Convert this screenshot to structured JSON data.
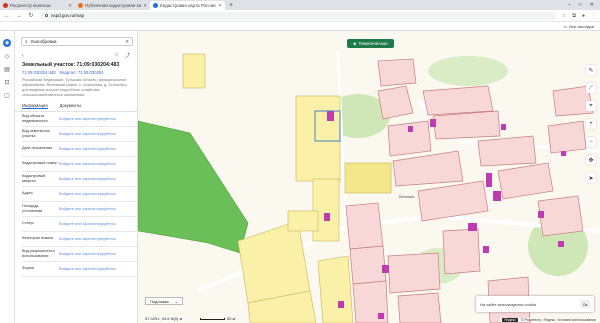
{
  "browser": {
    "tabs": [
      {
        "label": "Росреестр выписка",
        "favicon_color": "#d93025"
      },
      {
        "label": "Публичная кадастровая ка",
        "favicon_color": "#e8711a"
      },
      {
        "label": "Кадастровая карта России",
        "favicon_color": "#1e6fd9",
        "active": true
      }
    ],
    "new_tab": "+",
    "url": "nspd.gov.ru/map",
    "bookmarks_label": "Все закладки",
    "window_controls": [
      "–",
      "□",
      "✕"
    ]
  },
  "search": {
    "value": "Ушлобровка"
  },
  "object": {
    "title": "Земельный участок: 71:09:030204:483",
    "cadastral_link": "71:09:030204:483",
    "cadastral_link2": "Квартал: 71:09:030204",
    "description": "Российская Федерация, Тульская область, муниципальное образование, Веневский район, с. Апалькова, д. Устьвобро, для ведения личного подсобного хозяйства, сельскохозяйственного назначения"
  },
  "tabs": {
    "info": "Информация",
    "docs": "Документы"
  },
  "rows": [
    {
      "k": "Вид объекта недвижимости",
      "v": "Войдите или зарегистрируйтесь"
    },
    {
      "k": "Вид земельного участка",
      "v": "Войдите или зарегистрируйтесь"
    },
    {
      "k": "Дата присвоения",
      "v": "Войдите или зарегистрируйтесь"
    },
    {
      "k": "Кадастровый номер",
      "v": "Войдите или зарегистрируйтесь"
    },
    {
      "k": "Кадастровый квартал",
      "v": "Войдите или зарегистрируйтесь"
    },
    {
      "k": "Адрес",
      "v": "Войдите или зарегистрируйтесь"
    },
    {
      "k": "Площадь уточненная",
      "v": "Войдите или зарегистрируйтесь"
    },
    {
      "k": "Статус",
      "v": "Войдите или зарегистрируйтесь"
    },
    {
      "k": "Категория земель",
      "v": "Войдите или зарегистрируйтесь"
    },
    {
      "k": "Вид разрешенного использования",
      "v": "Войдите или зарегистрируйтесь"
    },
    {
      "k": "Форма",
      "v": "Войдите или зарегистрируйтесь"
    }
  ],
  "map": {
    "layer_button": "Тематическая",
    "basemap_select": "Подложка",
    "coords": "57.0291, 34.6 N(0) м",
    "scale": "50 м",
    "village_label": "Веневка",
    "cookie_text": "На сайте используются cookie",
    "cookie_ok": "Ок",
    "attribution": "© Росреестр, Яндекс. Условия использования",
    "attribution_logo": "Яндекс"
  },
  "colors": {
    "accent": "#1e6fd9",
    "layer_button": "#1f7a4a",
    "forest": "#6bbf59",
    "parcel_pink": "#f8d7d7",
    "parcel_yellow": "#fbf0a8",
    "building": "#c03ab0"
  }
}
